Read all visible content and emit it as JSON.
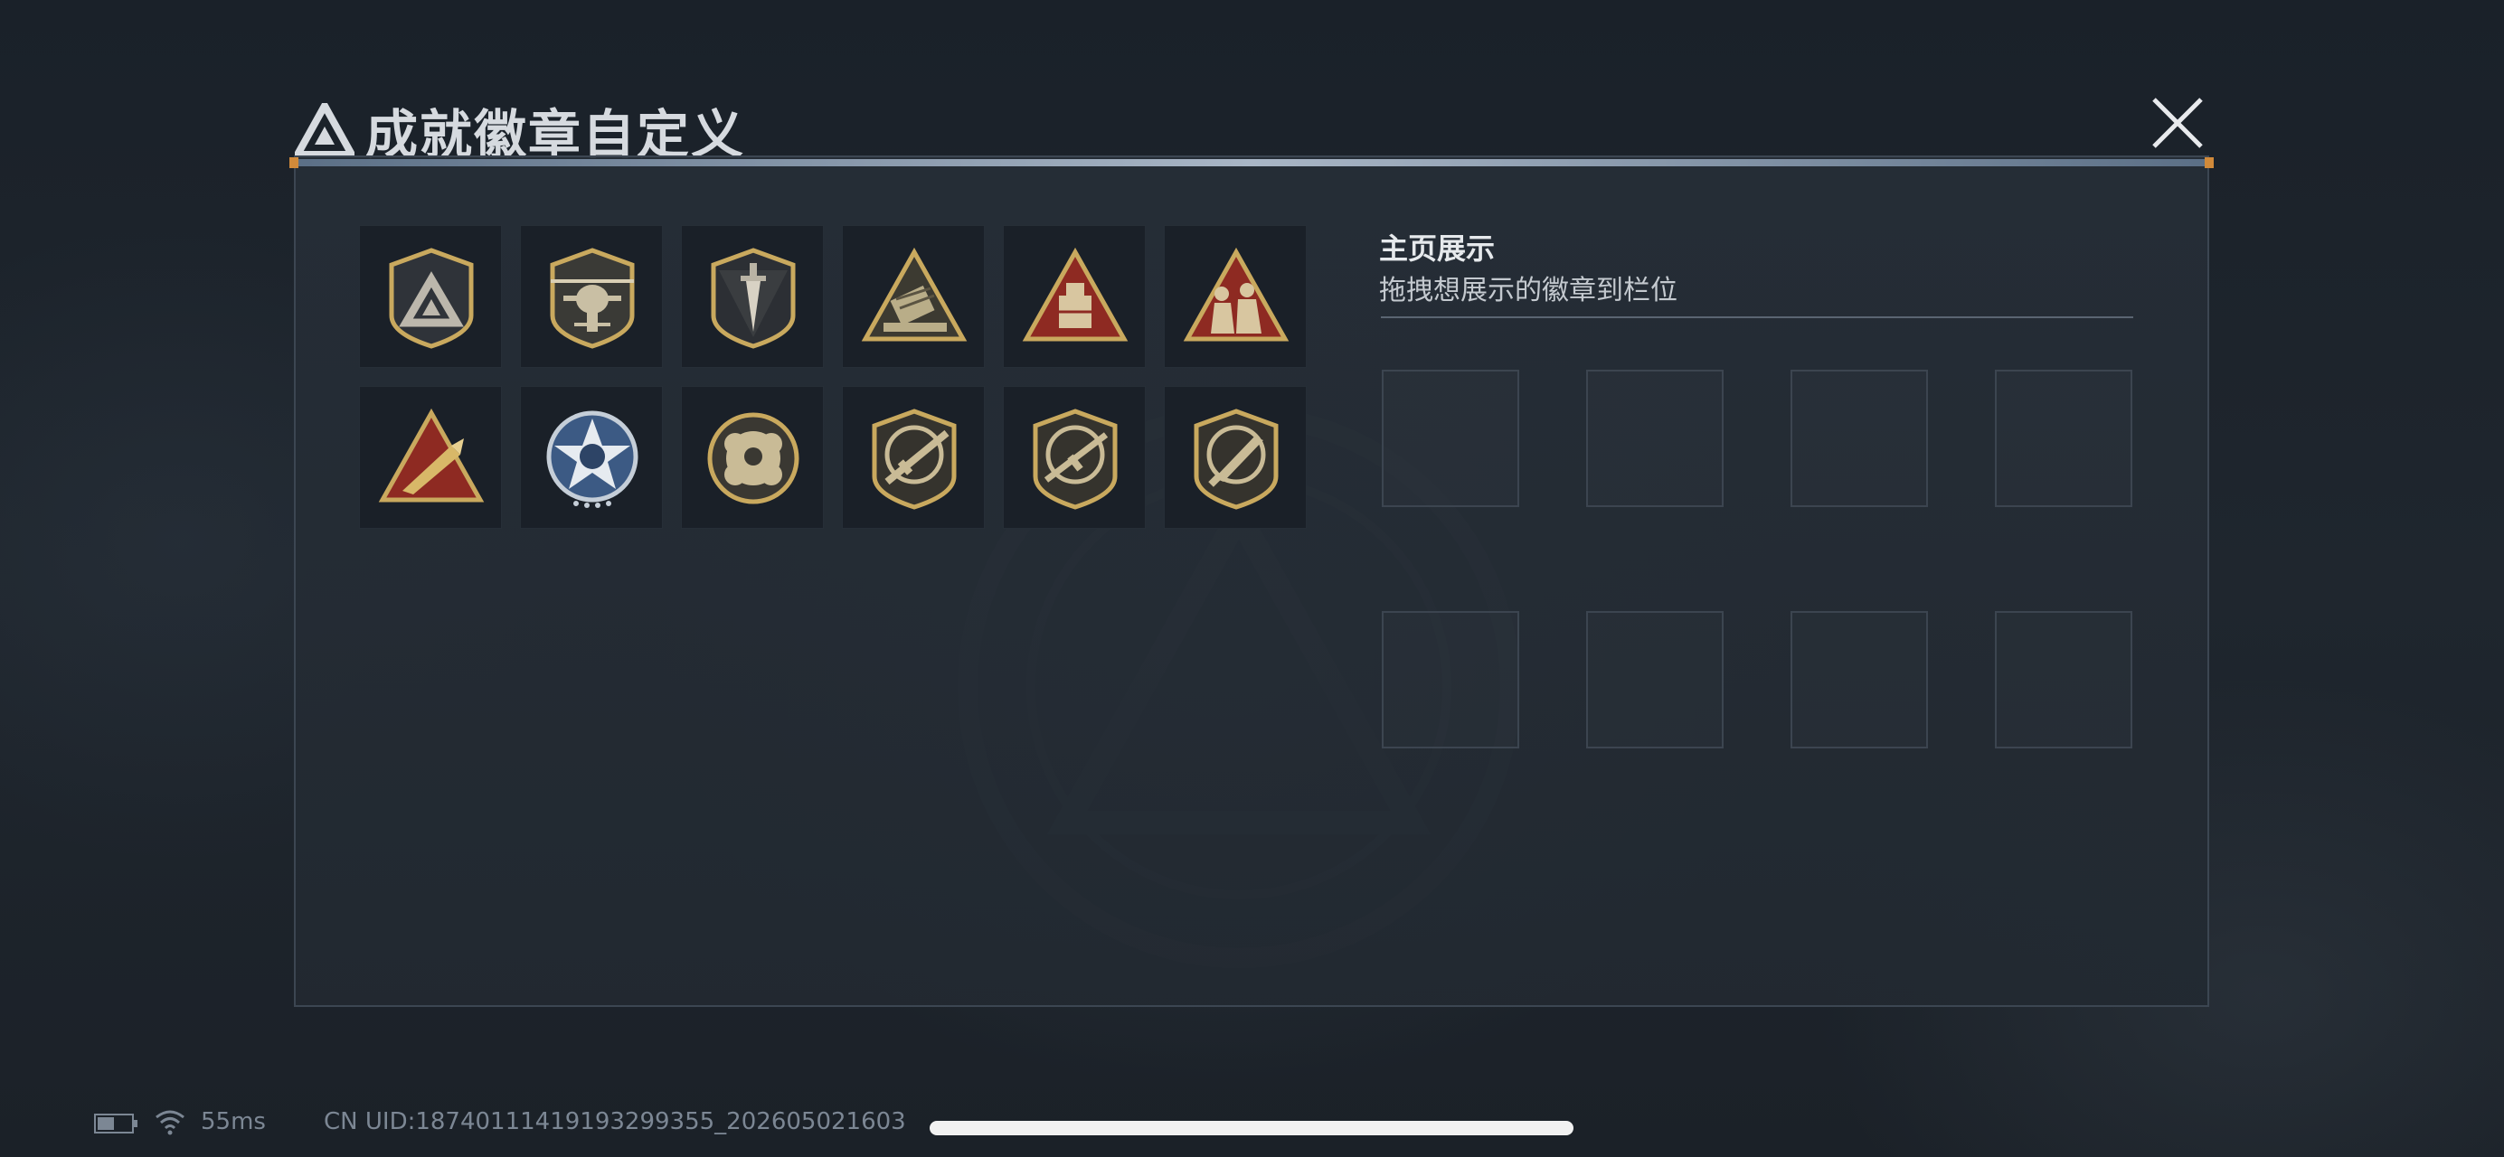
{
  "window": {
    "title": "成就徽章自定义",
    "title_icon": "delta-logo-icon",
    "close_icon": "close-icon"
  },
  "badges": [
    {
      "name": "delta-shield-badge",
      "icon": "delta-shield-icon"
    },
    {
      "name": "helicopter-badge",
      "icon": "helicopter-icon"
    },
    {
      "name": "dagger-shield-badge",
      "icon": "dagger-shield-icon"
    },
    {
      "name": "missile-launcher-badge",
      "icon": "missile-launcher-icon"
    },
    {
      "name": "red-crate-badge",
      "icon": "crate-icon"
    },
    {
      "name": "soldiers-badge",
      "icon": "soldiers-icon"
    },
    {
      "name": "rocket-triangle-badge",
      "icon": "rocket-icon"
    },
    {
      "name": "star-emblem-badge",
      "icon": "star-emblem-icon"
    },
    {
      "name": "gear-emblem-badge",
      "icon": "gear-emblem-icon"
    },
    {
      "name": "rifle-badge-1",
      "icon": "rifle-icon"
    },
    {
      "name": "rifle-badge-2",
      "icon": "rifle-icon"
    },
    {
      "name": "knife-badge",
      "icon": "knife-icon"
    }
  ],
  "showcase": {
    "title": "主页展示",
    "subtitle": "拖拽想展示的徽章到栏位",
    "slot_count": 8
  },
  "status_bar": {
    "battery_icon": "battery-icon",
    "wifi_icon": "wifi-icon",
    "ping": "55ms",
    "uid": "CN UID:1874011141919329​9355_202605021603"
  },
  "colors": {
    "gold": "#c9a95e",
    "dark_gold": "#8c7338",
    "accent_red": "#8e2a22",
    "panel_bg": "#262e37"
  }
}
